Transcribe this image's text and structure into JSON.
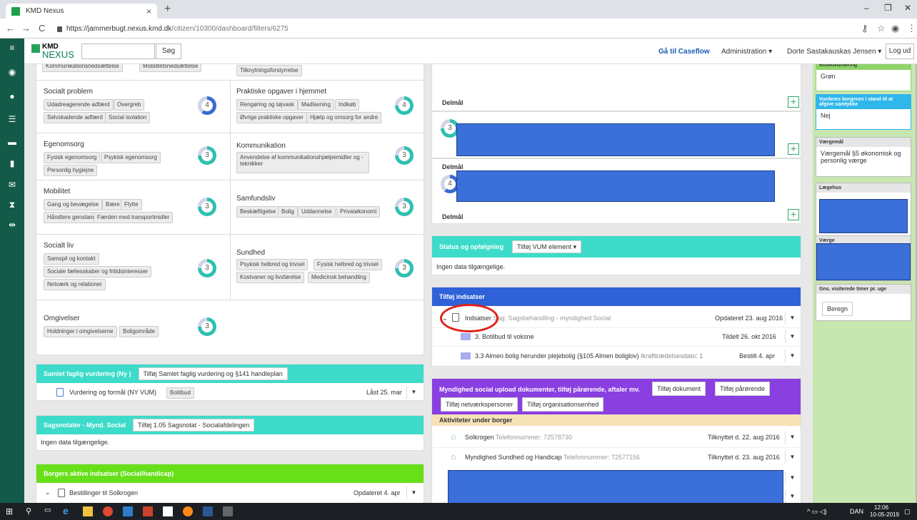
{
  "browser": {
    "tab_title": "KMD Nexus",
    "url_host": "https://jammerbugt.nexus.kmd.dk",
    "url_path": "/citizen/10300/dashboard/filters/6275"
  },
  "header": {
    "brand_top": "KMD",
    "brand_bottom": "NEXUS",
    "search_button": "Søg",
    "caseflow": "Gå til Caseflow",
    "admin": "Administration ▾",
    "user": "Dorte Sastakauskas Jensen ▾",
    "logout": "Log ud"
  },
  "grid": {
    "top_tags_left": [
      "Kommunikationsnedsættelse",
      "Mobilitetsnedsættelse"
    ],
    "top_tag_right": "Tilknytningsforstyrrelse",
    "socialt_problem": {
      "title": "Socialt problem",
      "tags": [
        "Udadreagerende adfærd",
        "Overgreb",
        "Selvskadende adfærd",
        "Social isolation"
      ],
      "count": "4"
    },
    "praktiske": {
      "title": "Praktiske opgaver i hjemmet",
      "tags": [
        "Rengøring og tøjvask",
        "Madlavning",
        "Indkøb",
        "Øvrige praktiske opgaver",
        "Hjælp og omsorg for andre"
      ],
      "count": "4"
    },
    "egenomsorg": {
      "title": "Egenomsorg",
      "tags": [
        "Fysisk egenomsorg",
        "Psykisk egenomsorg",
        "Personlig hygiejne"
      ],
      "count": "3"
    },
    "kommunikation": {
      "title": "Kommunikation",
      "tags": [
        "Anvendelse af kommunikationshjælpemidler og -",
        "teknikker"
      ],
      "count": "3"
    },
    "mobilitet": {
      "title": "Mobilitet",
      "tags": [
        "Gang og bevægelse",
        "Bære",
        "Flytte",
        "Håndtere genstande",
        "Færden med transportmidler"
      ],
      "count": "3"
    },
    "samfundsliv": {
      "title": "Samfundsliv",
      "tags": [
        "Beskæftigelse",
        "Bolig",
        "Uddannelse",
        "Privatøkonomi"
      ],
      "count": "3"
    },
    "socialt_liv": {
      "title": "Socialt liv",
      "tags": [
        "Samspil og kontakt",
        "Sociale fællesskaber og fritidsinteresser",
        "Netværk og relationer"
      ],
      "count": "3"
    },
    "sundhed": {
      "title": "Sundhed",
      "tags": [
        "Psykisk helbred og trivsel",
        "Fysisk helbred og trivsel",
        "Kostvaner og livsførelse",
        "Medicinsk behandling"
      ],
      "count": "3"
    },
    "omgivelser": {
      "title": "Omgivelser",
      "tags": [
        "Holdninger i omgivelserne",
        "Boligområde"
      ],
      "count": "3"
    }
  },
  "samlet": {
    "title": "Samlet faglig vurdering (Ny )",
    "button": "Tilføj Samlet faglig vurdering og §141 handleplan",
    "row": "Vurdering og formål (NY VUM)",
    "row_tag": "Botilbud",
    "row_date": "Låst 25. mar"
  },
  "sagsnotater": {
    "title": "Sagsnotater - Mynd. Social",
    "button": "Tilføj 1.05 Sagsnotat - Socialafdelingen",
    "empty": "Ingen data tilgængelige."
  },
  "aktive": {
    "title": "Borgers aktive indsatser (Social/handicap)",
    "row": "Bestillinger til Solkrogen",
    "row_date": "Opdateret 4. apr"
  },
  "delmaal": {
    "label": "Delmål",
    "count1": "3",
    "count2": "4"
  },
  "status": {
    "title": "Status og opfølgning",
    "button": "Tilføj VUM element ▾",
    "empty": "Ingen data tilgængelige."
  },
  "indsatser": {
    "title": "Tilføj indsatser",
    "row1_a": "Indsatser",
    "row1_b": "Sag: Sagsbehandling - myndighed Social",
    "row1_date": "Opdateret 23. aug 2016",
    "row2": "3. Botilbud til voksne",
    "row2_date": "Tildelt 26. okt 2016",
    "row3": "3.3 Almen bolig herunder plejebolig (§105 Almen boliglov)",
    "row3_extra": "Ikrafttrædelsesdato: 1",
    "row3_date": "Bestilt 4. apr"
  },
  "myndighed": {
    "title": "Myndighed social upload dokumenter, tilføj pårørende, aftaler mv.",
    "btn1": "Tilføj dokument",
    "btn2": "Tilføj pårørende",
    "btn3": "Tilføj netværkspersoner",
    "btn4": "Tilføj organisationsenhed",
    "sub": "Aktiviteter under borger",
    "a1": "Solkrogen",
    "a1_tel": "Telefonnummer: 72578730",
    "a1_date": "Tilknyttet d. 22. aug 2016",
    "a2": "Myndighed Sundhed og Handicap",
    "a2_tel": "Telefonnummer: 72577156",
    "a2_date": "Tilknyttet d. 23. aug 2016"
  },
  "right": {
    "risiko_h": "Risikovurdering",
    "risiko_v": "Grøn",
    "vurderes_h": "Vurderes borgeren i stand til at afgive samtykke",
    "vurderes_v": "Nej",
    "vaerge_h": "Værgemål",
    "vaerge_v": "Værgemål §5 økonomisk og personlig værge",
    "laege_h": "Lægehus",
    "vaerge2_h": "Værge",
    "gns_h": "Gns. visiterede timer pr. uge",
    "beregn": "Beregn"
  },
  "taskbar": {
    "lang": "DAN",
    "time": "12:06",
    "date": "10-05-2019"
  },
  "colors": {
    "teal": "#3ddbc9",
    "blue": "#2f62d9",
    "purple": "#8a3fe0",
    "green": "#67e01a"
  }
}
